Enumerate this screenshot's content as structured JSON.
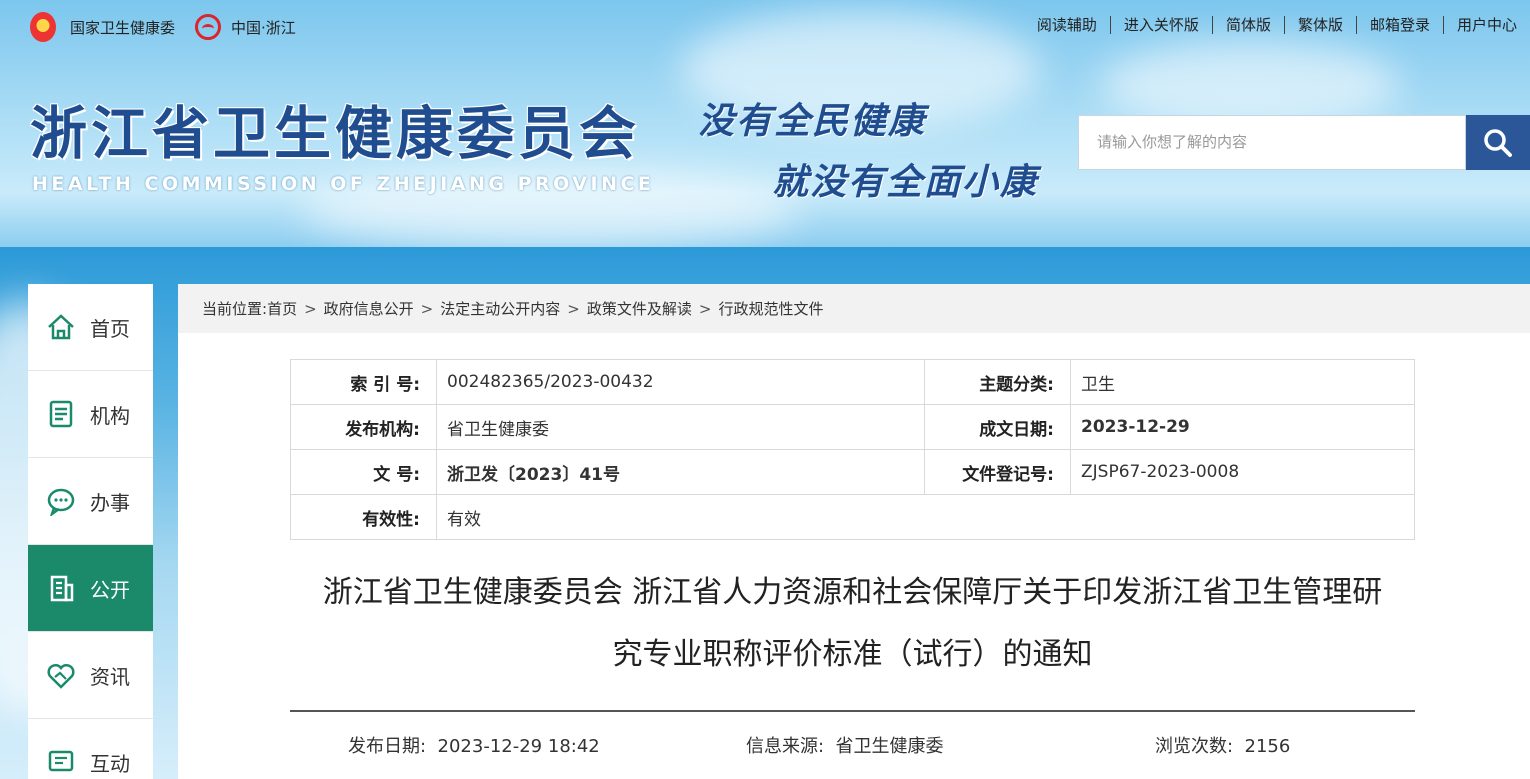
{
  "topbar": {
    "agency": "国家卫生健康委",
    "region": "中国·浙江",
    "links": [
      "阅读辅助",
      "进入关怀版",
      "简体版",
      "繁体版",
      "邮箱登录",
      "用户中心"
    ]
  },
  "header": {
    "title": "浙江省卫生健康委员会",
    "subtitle": "HEALTH COMMISSION OF ZHEJIANG PROVINCE",
    "slogan_line1": "没有全民健康",
    "slogan_line2": "就没有全面小康"
  },
  "search": {
    "placeholder": "请输入你想了解的内容",
    "icon": "search-icon"
  },
  "sidebar": {
    "items": [
      {
        "label": "首页",
        "icon": "home-icon"
      },
      {
        "label": "机构",
        "icon": "document-icon"
      },
      {
        "label": "办事",
        "icon": "chat-icon"
      },
      {
        "label": "公开",
        "icon": "building-icon",
        "active": true
      },
      {
        "label": "资讯",
        "icon": "handshake-icon"
      },
      {
        "label": "互动",
        "icon": "message-icon"
      }
    ]
  },
  "breadcrumb": {
    "prefix": "当前位置:",
    "items": [
      "首页",
      "政府信息公开",
      "法定主动公开内容",
      "政策文件及解读",
      "行政规范性文件"
    ]
  },
  "meta": {
    "index_no_label": "索 引 号:",
    "index_no": "002482365/2023-00432",
    "topic_label": "主题分类:",
    "topic": "卫生",
    "publisher_label": "发布机构:",
    "publisher": "省卫生健康委",
    "date_label": "成文日期:",
    "date": "2023-12-29",
    "doc_no_label": "文  号:",
    "doc_no": "浙卫发〔2023〕41号",
    "reg_no_label": "文件登记号:",
    "reg_no": "ZJSP67-2023-0008",
    "validity_label": "有效性:",
    "validity": "有效"
  },
  "document": {
    "title_line1": "浙江省卫生健康委员会 浙江省人力资源和社会保障厅关于印发浙江省卫生管理研",
    "title_line2": "究专业职称评价标准（试行）的通知",
    "pub_date_label": "发布日期:",
    "pub_date": "2023-12-29 18:42",
    "source_label": "信息来源:",
    "source": "省卫生健康委",
    "views_label": "浏览次数:",
    "views": "2156"
  },
  "colors": {
    "brand_blue": "#2b5798",
    "active_green": "#1b8a6b",
    "title_blue": "#1f4d8f"
  }
}
